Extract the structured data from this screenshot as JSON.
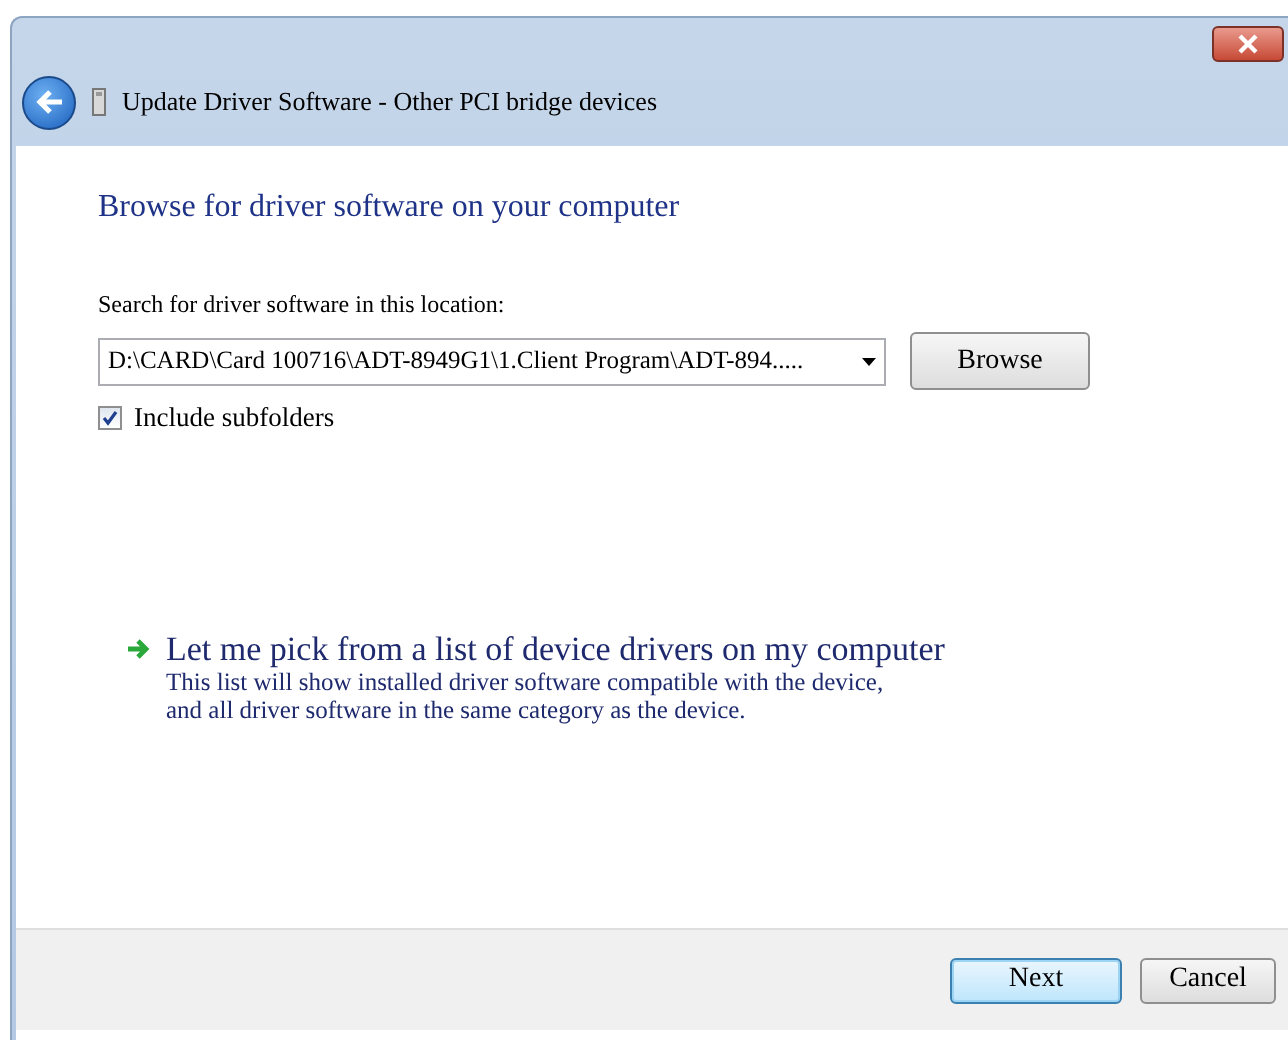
{
  "window": {
    "title": "Update Driver Software - Other PCI bridge devices"
  },
  "heading": "Browse for driver software on your computer",
  "search": {
    "label": "Search for driver software in this location:",
    "value": "D:\\CARD\\Card 100716\\ADT-8949G1\\1.Client Program\\ADT-894.....",
    "browse": "Browse"
  },
  "include_subfolders": {
    "label": "Include subfolders",
    "checked": true
  },
  "pick_option": {
    "title": "Let me pick from a list of device drivers on my computer",
    "description": "This list will show installed driver software compatible with the device,\nand all driver software in the same category as the device."
  },
  "buttons": [
    {
      "label": "Next",
      "kind": "default"
    },
    {
      "label": "Cancel",
      "kind": "normal"
    }
  ]
}
